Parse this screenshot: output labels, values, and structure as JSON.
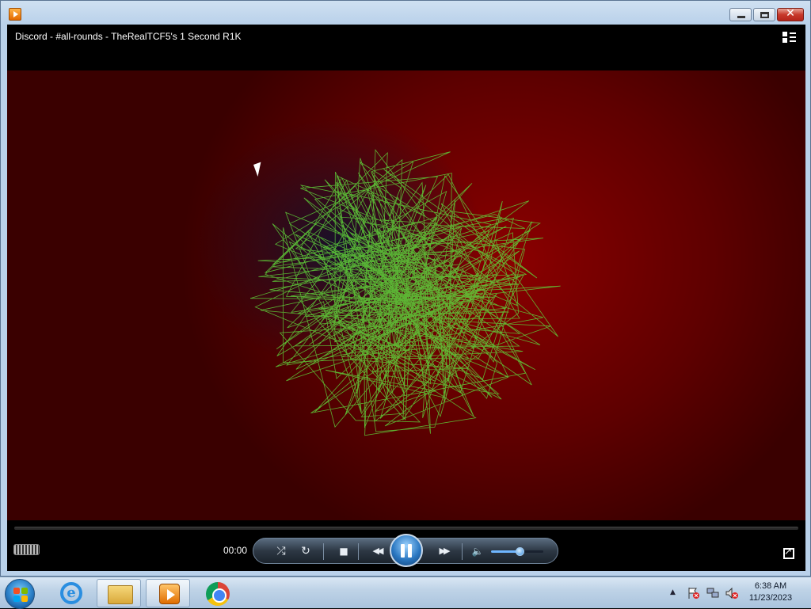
{
  "window": {
    "title": "Discord - #all-rounds - TheRealTCF5's 1 Second R1K",
    "close_glyph": "✕"
  },
  "player": {
    "time": "00:00",
    "progress": 0.0,
    "volume": 0.55,
    "state": "playing",
    "icons": {
      "grip": "status-grip-icon",
      "shuffle": "shuffle-icon",
      "repeat": "repeat-icon",
      "stop": "stop-icon",
      "previous": "previous-icon",
      "pause": "pause-icon",
      "next": "next-icon",
      "mute": "speaker-icon",
      "fullscreen": "fullscreen-icon",
      "switch_library": "switch-to-library-icon"
    },
    "glyphs": {
      "shuffle": "⤮",
      "repeat": "↻",
      "stop": "■",
      "previous": "◀◀",
      "next": "▶▶",
      "mute": "🔈"
    },
    "colors": {
      "video_bg": "#6a0000",
      "scribble": "#5fd13a",
      "accent": "#2b78c2"
    }
  },
  "taskbar": {
    "items": [
      "start-orb",
      "internet-explorer",
      "windows-explorer",
      "windows-media-player",
      "google-chrome"
    ],
    "clock": {
      "time": "6:38 AM",
      "date": "11/23/2023"
    },
    "tray_arrow": "▲"
  }
}
